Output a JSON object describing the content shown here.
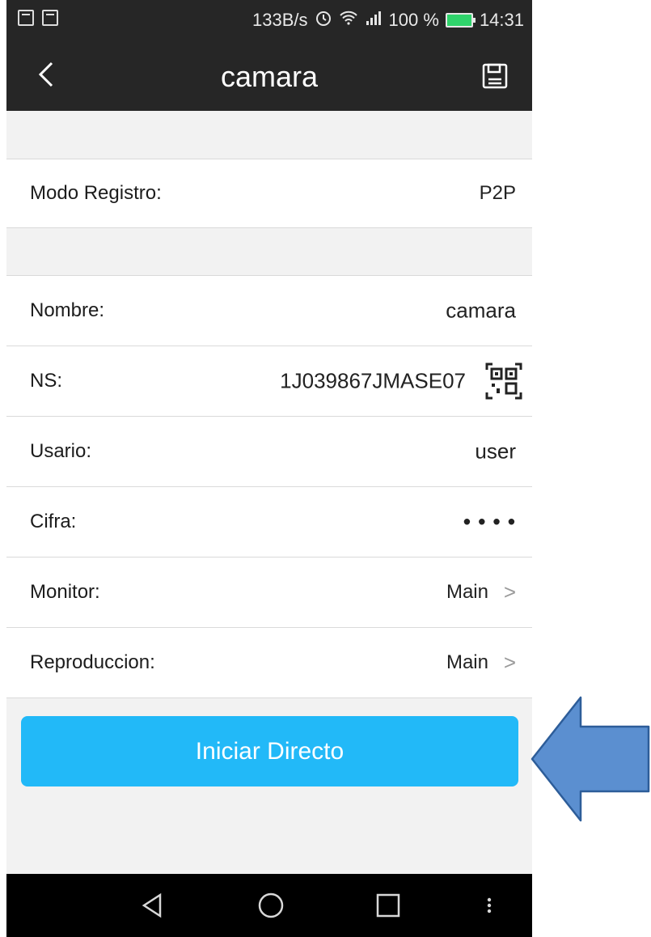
{
  "status_bar": {
    "network_speed": "133B/s",
    "battery_percent": "100 %",
    "time": "14:31"
  },
  "header": {
    "title": "camara"
  },
  "form": {
    "modo_registro": {
      "label": "Modo Registro:",
      "value": "P2P"
    },
    "nombre": {
      "label": "Nombre:",
      "value": "camara"
    },
    "ns": {
      "label": "NS:",
      "value": "1J039867JMASE07"
    },
    "usuario": {
      "label": "Usario:",
      "value": "user"
    },
    "cifra": {
      "label": "Cifra:",
      "value": "• • • •"
    },
    "monitor": {
      "label": "Monitor:",
      "value": "Main"
    },
    "reproduccion": {
      "label": "Reproduccion:",
      "value": "Main"
    }
  },
  "actions": {
    "start_label": "Iniciar Directo"
  },
  "colors": {
    "accent": "#22b9f8",
    "header_bg": "#262626",
    "arrow": "#5b8fd0"
  }
}
